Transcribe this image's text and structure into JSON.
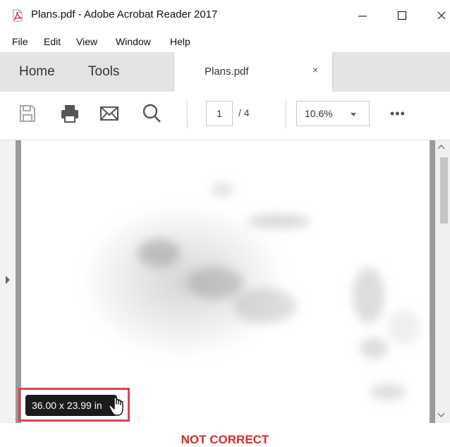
{
  "window": {
    "title": "Plans.pdf - Adobe Acrobat Reader 2017",
    "app_icon": "acrobat-pdf-icon"
  },
  "menu": [
    "File",
    "Edit",
    "View",
    "Window",
    "Help"
  ],
  "tabs": {
    "home": "Home",
    "tools": "Tools",
    "document": "Plans.pdf",
    "close_glyph": "×"
  },
  "toolbar": {
    "icons": [
      "save-icon",
      "print-icon",
      "email-icon",
      "search-icon"
    ],
    "current_page": "1",
    "page_total": "/ 4",
    "zoom": "10.6%",
    "more": "•••"
  },
  "page_size_tooltip": "36.00 x 23.99 in",
  "caption": "NOT CORRECT",
  "colors": {
    "highlight": "#e0424c",
    "caption": "#e5252a",
    "tooltip_bg": "#1b1b1b"
  }
}
